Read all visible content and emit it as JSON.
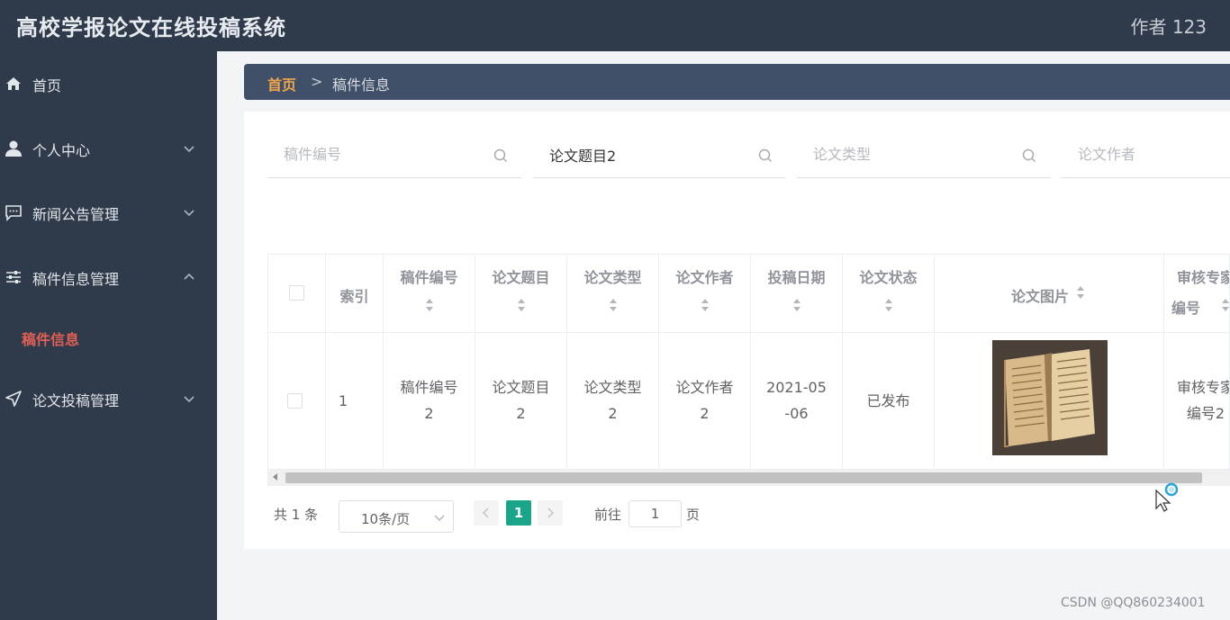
{
  "app": {
    "title": "高校学报论文在线投稿系统",
    "user": "作者 123"
  },
  "sidebar": {
    "items": [
      {
        "label": "首页",
        "icon": "home-icon"
      },
      {
        "label": "个人中心",
        "icon": "user-icon"
      },
      {
        "label": "新闻公告管理",
        "icon": "message-icon"
      },
      {
        "label": "稿件信息管理",
        "icon": "sliders-icon"
      },
      {
        "label": "论文投稿管理",
        "icon": "send-icon"
      }
    ],
    "sub_item": "稿件信息"
  },
  "breadcrumb": {
    "home": "首页",
    "separator": ">",
    "current": "稿件信息"
  },
  "search": {
    "fields": [
      {
        "placeholder": "稿件编号",
        "value": ""
      },
      {
        "placeholder": "论文题目",
        "value": "论文题目2"
      },
      {
        "placeholder": "论文类型",
        "value": ""
      },
      {
        "placeholder": "论文作者",
        "value": ""
      }
    ]
  },
  "table": {
    "headers": [
      "索引",
      "稿件编号",
      "论文题目",
      "论文类型",
      "论文作者",
      "投稿日期",
      "论文状态",
      "论文图片",
      "审核专家",
      "编号"
    ],
    "row": {
      "index": "1",
      "manuscript_no": [
        "稿件编号",
        "2"
      ],
      "title": [
        "论文题目",
        "2"
      ],
      "type": [
        "论文类型",
        "2"
      ],
      "author": [
        "论文作者",
        "2"
      ],
      "date": [
        "2021-05",
        "-06"
      ],
      "status": "已发布",
      "image": "book-thumbnail",
      "expert": [
        "审核专家",
        "编号2"
      ]
    }
  },
  "pagination": {
    "total": "共 1 条",
    "page_size": "10条/页",
    "current": "1",
    "goto_label": "前往",
    "goto_value": "1",
    "page_label": "页"
  },
  "watermark": "CSDN @QQ860234001",
  "colors": {
    "sidebar": "#2f3a4b",
    "breadcrumb": "#3f5068",
    "accent": "#1aa48a",
    "home_link": "#f0a64a",
    "active_sub": "#e15f53"
  }
}
